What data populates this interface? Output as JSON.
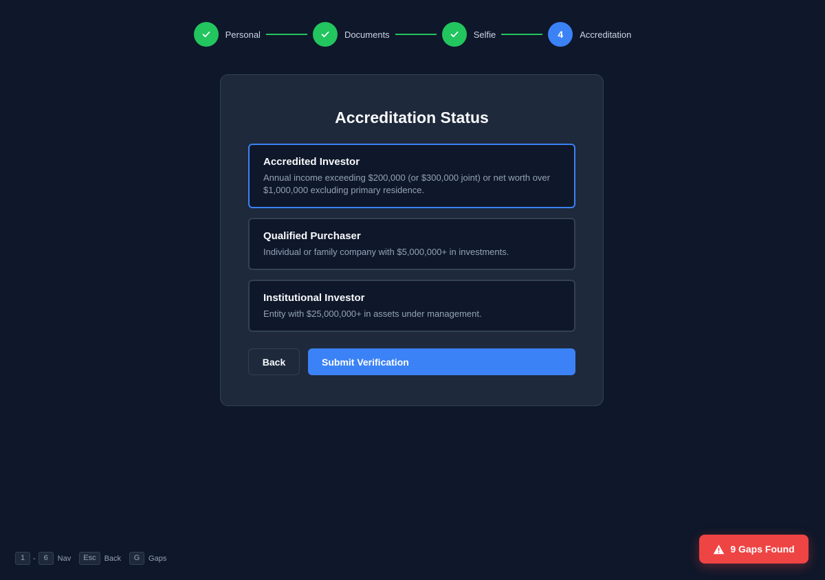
{
  "stepper": {
    "steps": [
      {
        "label": "Personal",
        "status": "done"
      },
      {
        "label": "Documents",
        "status": "done"
      },
      {
        "label": "Selfie",
        "status": "done"
      },
      {
        "label": "Accreditation",
        "status": "active",
        "number": "4"
      }
    ]
  },
  "card": {
    "title": "Accreditation Status",
    "options": [
      {
        "title": "Accredited Investor",
        "description": "Annual income exceeding $200,000 (or $300,000 joint) or net worth over $1,000,000 excluding primary residence.",
        "selected": true
      },
      {
        "title": "Qualified Purchaser",
        "description": "Individual or family company with $5,000,000+ in investments.",
        "selected": false
      },
      {
        "title": "Institutional Investor",
        "description": "Entity with $25,000,000+ in assets under management.",
        "selected": false
      }
    ],
    "back_label": "Back",
    "submit_label": "Submit Verification"
  },
  "shortcuts": {
    "key_first": "1",
    "separator": "-",
    "key_last": "6",
    "nav_label": "Nav",
    "esc_key": "Esc",
    "back_label": "Back",
    "gaps_key": "G",
    "gaps_label": "Gaps"
  },
  "gaps_badge": {
    "label": "9 Gaps Found",
    "icon": "warning-icon"
  },
  "colors": {
    "background": "#0f172a",
    "card": "#1e293b",
    "accent": "#3b82f6",
    "success": "#22c55e",
    "danger": "#ef4444"
  }
}
